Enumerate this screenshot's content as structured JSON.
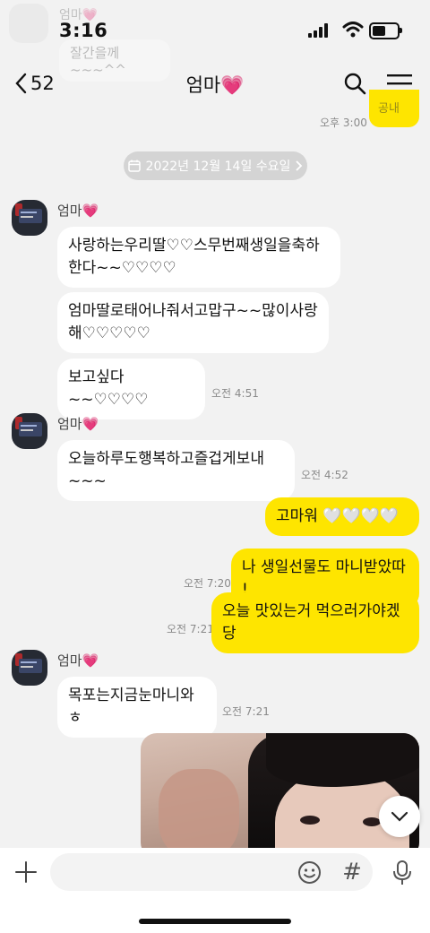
{
  "status_bar": {
    "time": "3:16"
  },
  "ghost_notification": {
    "name": "엄마💗",
    "preview": "잘간을께~~~^^"
  },
  "header": {
    "back_count": "52",
    "title": "엄마💗"
  },
  "previous": {
    "partial_text": "공내",
    "time": "오후 3:00"
  },
  "date_divider": {
    "label": "2022년 12월 14일 수요일"
  },
  "messages": {
    "g1": {
      "sender": "엄마💗",
      "b1": "사랑하는우리딸♡♡스무번째생일을축하한다~~♡♡♡♡",
      "b2": "엄마딸로태어나줘서고맙구~~많이사랑해♡♡♡♡♡",
      "b3": "보고싶다~~♡♡♡♡",
      "time": "오전 4:51"
    },
    "g2": {
      "sender": "엄마💗",
      "b1": "오늘하루도행복하고즐겁게보내~~~",
      "time": "오전 4:52"
    },
    "mine": {
      "b1": "고마워 🤍🤍🤍🤍",
      "b2": "나 생일선물도 마니받았따 !",
      "b2_time": "오전 7:20",
      "b3": "오늘 맛있는거 먹으러가야겠당",
      "b3_time": "오전 7:21"
    },
    "g3": {
      "sender": "엄마💗",
      "b1": "목포는지금눈마니와ㅎ",
      "time": "오전 7:21"
    }
  },
  "input": {
    "placeholder": ""
  },
  "colors": {
    "bg": "#f2f2f2",
    "my_bubble": "#fee500",
    "their_bubble": "#ffffff"
  }
}
